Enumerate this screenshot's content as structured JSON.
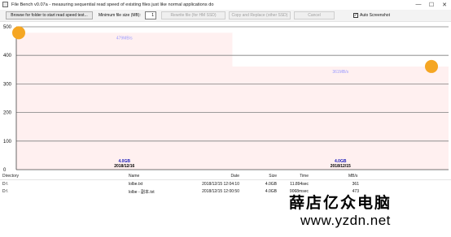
{
  "window": {
    "title": "File Bench v0.07a - measuring sequential read speed of existing files just like normal applications do",
    "minimize": "—",
    "maximize": "☐",
    "close": "✕"
  },
  "toolbar": {
    "browse_label": "Browse for folder to start read speed test...",
    "min_size_label": "Minimum file size (MB):",
    "min_size_value": "1",
    "rewrite_label": "Rewrite file (for HM SSD)",
    "copy_label": "Copy and Replace (other SSD)",
    "cancel_label": "Cancel",
    "auto_screenshot_label": "Auto Screenshot",
    "auto_screenshot_checked": "✓"
  },
  "chart_data": {
    "type": "bar",
    "ylim": [
      0,
      500
    ],
    "yticks": [
      0,
      100,
      200,
      300,
      400,
      500
    ],
    "grid": true,
    "bar_color": "#fff0f0",
    "bars": [
      {
        "speed_label": "479MB/s",
        "value": 479,
        "size_label": "4.0GB",
        "date_label": "2018/12/16"
      },
      {
        "speed_label": "361MB/s",
        "value": 361,
        "size_label": "4.0GB",
        "date_label": "2018/12/15"
      }
    ],
    "marker_color": "#f5a623"
  },
  "table": {
    "headers": {
      "directory": "Directory",
      "name": "Name",
      "date": "Date",
      "size": "Size",
      "time": "Time",
      "mbs": "MB/s"
    },
    "rows": [
      {
        "directory": "D:\\",
        "name": "lolbe.txt",
        "date": "2018/12/15 12:04:10",
        "size": "4.0GB",
        "time": "11.894sec",
        "mbs": "361"
      },
      {
        "directory": "D:\\",
        "name": "lolbe - 副本.txt",
        "date": "2018/12/15 12:00:50",
        "size": "4.0GB",
        "time": "9068msec",
        "mbs": "473"
      }
    ]
  },
  "watermark": {
    "chinese": "薛店亿众电脑",
    "url": "www.yzdn.net"
  }
}
